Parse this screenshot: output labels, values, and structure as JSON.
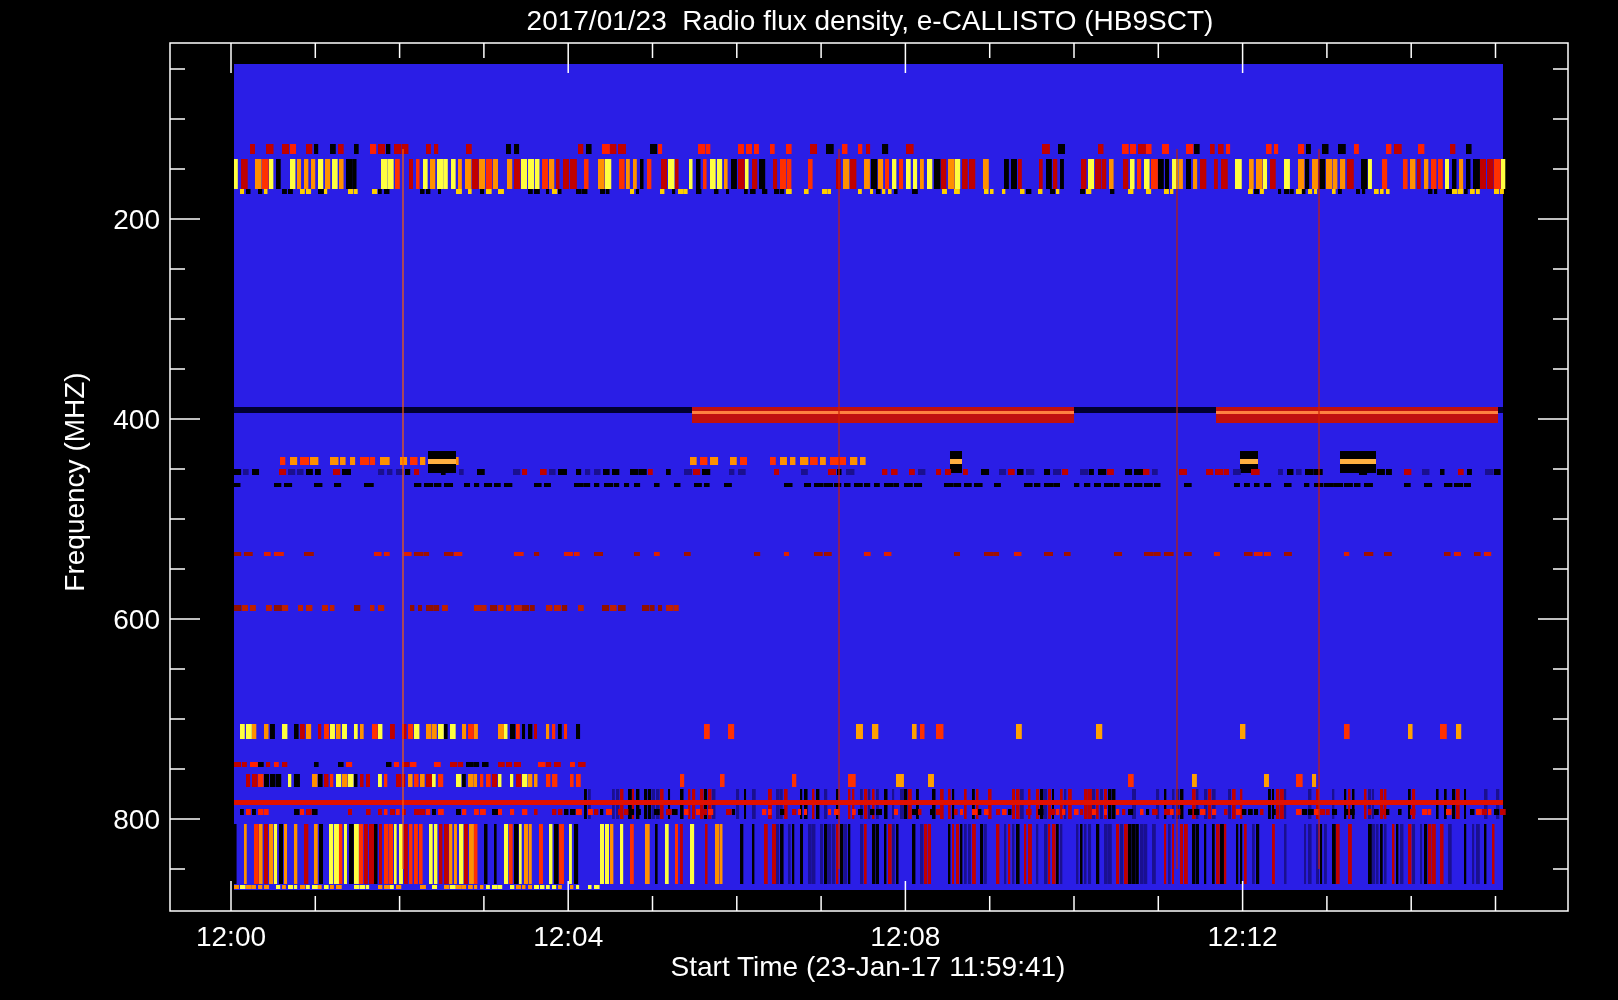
{
  "title": "2017/01/23  Radio flux density, e-CALLISTO (HB9SCT)",
  "y_axis": {
    "label": "Frequency (MHZ)",
    "ticks": [
      "200",
      "400",
      "600",
      "800"
    ]
  },
  "x_axis": {
    "label": "Start Time (23-Jan-17 11:59:41)",
    "ticks": [
      "12:00",
      "12:04",
      "12:08",
      "12:12"
    ]
  }
}
